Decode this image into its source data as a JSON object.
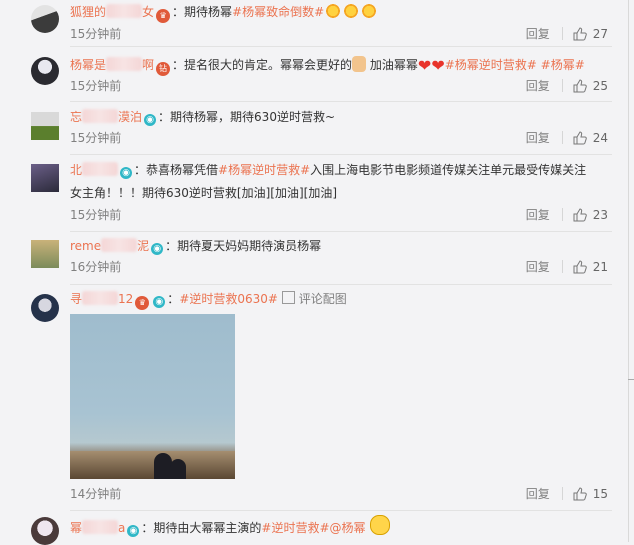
{
  "comments": [
    {
      "user": "狐狸的",
      "user_tail": "女",
      "sep": "：",
      "text": "期待杨幂",
      "tags": [
        "#杨幂致命倒数#"
      ],
      "time": "15分钟前",
      "reply": "回复",
      "likes": "27",
      "avatar_colors": [
        "#e3e3e3",
        "#3b3b3b"
      ]
    },
    {
      "user": "杨幂是",
      "user_tail": "啊",
      "sep": "：",
      "text": "提名很大的肯定。幂幂会更好的",
      "text2": "加油幂幂",
      "tags": [
        "#杨幂逆时营救#",
        "#杨幂#"
      ],
      "time": "15分钟前",
      "reply": "回复",
      "likes": "25",
      "avatar_colors": [
        "#e8e8f0",
        "#2a2a30"
      ]
    },
    {
      "user": "忘",
      "user_tail": "漠泊",
      "sep": "：",
      "text": "期待杨幂，期待630逆时营救~",
      "time": "15分钟前",
      "reply": "回复",
      "likes": "24",
      "avatar_colors": [
        "#5b7f2d",
        "#d9d9d9"
      ]
    },
    {
      "user": "北",
      "user_tail": "",
      "sep": "：",
      "text_pre": "恭喜杨幂凭借",
      "tags": [
        "#杨幂逆时营救#"
      ],
      "text_post": "入围上海电影节电影频道传媒关注单元最受传媒关注",
      "text_line2": "女主角！！！期待630逆时营救[加油][加油][加油]",
      "time": "15分钟前",
      "reply": "回复",
      "likes": "23",
      "avatar_colors": [
        "#2b2a3a",
        "#6b5f88"
      ]
    },
    {
      "user": "reme",
      "user_tail": "泥",
      "sep": "：",
      "text": "期待夏天妈妈期待演员杨幂",
      "time": "16分钟前",
      "reply": "回复",
      "likes": "21",
      "avatar_colors": [
        "#c9b27a",
        "#7b8b5a"
      ]
    },
    {
      "user": "寻",
      "user_tail": "12",
      "sep": "：",
      "tags": [
        "#逆时营救0630#"
      ],
      "pic_label": "评论配图",
      "time": "14分钟前",
      "reply": "回复",
      "likes": "15",
      "avatar_colors": [
        "#d7d7e0",
        "#25324a"
      ]
    },
    {
      "user": "幂",
      "user_tail": "a",
      "sep": "：",
      "text": "期待由大幂幂主演的",
      "tags": [
        "#逆时营救#"
      ],
      "at": "@杨幂",
      "avatar_colors": [
        "#efe6ef",
        "#4a3a3a"
      ]
    }
  ],
  "icons": {
    "thumb": "thumbs-up-icon",
    "verified": "verified-badge-icon",
    "emoji_sun": "sun-emoji-icon",
    "emoji_heart": "heart-emoji-icon",
    "emoji_face": "face-emoji-icon",
    "picture": "picture-icon"
  },
  "colors": {
    "link": "#eb7350",
    "meta": "#808080",
    "background": "#f3f3f5"
  }
}
